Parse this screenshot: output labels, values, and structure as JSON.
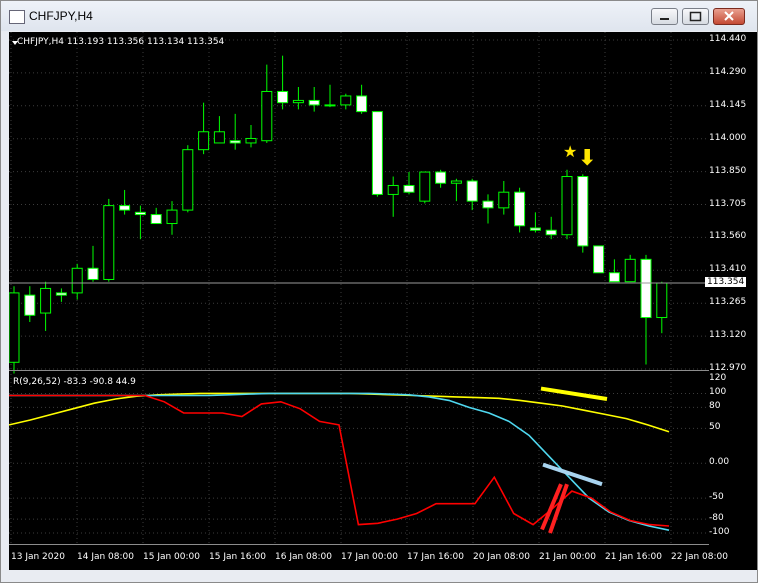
{
  "window": {
    "title": "CHFJPY,H4",
    "buttons": [
      "minimize",
      "maximize",
      "close"
    ]
  },
  "price_panel": {
    "info_text": "CHFJPY,H4  113.193 113.356 113.134 113.354",
    "current_price": "113.354",
    "y_labels": [
      "114.440",
      "114.290",
      "114.145",
      "114.000",
      "113.850",
      "113.705",
      "113.560",
      "113.410",
      "113.265",
      "113.120",
      "112.970"
    ]
  },
  "indicator_panel": {
    "info_text": "R(9,26,52) -83.3 -90.8 44.9",
    "y_labels": [
      "120",
      "100",
      "80",
      "50",
      "0.00",
      "-50",
      "-80",
      "-100"
    ]
  },
  "x_labels": [
    "13 Jan 2020",
    "14 Jan 08:00",
    "15 Jan 00:00",
    "15 Jan 16:00",
    "16 Jan 08:00",
    "17 Jan 00:00",
    "17 Jan 16:00",
    "20 Jan 08:00",
    "21 Jan 00:00",
    "21 Jan 16:00",
    "22 Jan 08:00"
  ],
  "colors": {
    "background": "#000000",
    "bull_candle": "#000000",
    "bear_candle": "#ffffff",
    "wick": "#00ff00",
    "line_red": "#ff0000",
    "line_cyan": "#4fd8f0",
    "line_yellow": "#ffff00",
    "star_arrow": "#ffe600",
    "drawn_red": "#ff2020",
    "drawn_blue": "#a8d4f0"
  },
  "chart_data": {
    "type": "candlestick",
    "price_range": [
      112.97,
      114.44
    ],
    "candles": [
      {
        "o": 113.0,
        "h": 113.34,
        "l": 112.95,
        "c": 113.31
      },
      {
        "o": 113.3,
        "h": 113.34,
        "l": 113.18,
        "c": 113.21
      },
      {
        "o": 113.22,
        "h": 113.36,
        "l": 113.14,
        "c": 113.33
      },
      {
        "o": 113.31,
        "h": 113.33,
        "l": 113.27,
        "c": 113.3
      },
      {
        "o": 113.31,
        "h": 113.44,
        "l": 113.28,
        "c": 113.42
      },
      {
        "o": 113.42,
        "h": 113.52,
        "l": 113.36,
        "c": 113.37
      },
      {
        "o": 113.37,
        "h": 113.73,
        "l": 113.36,
        "c": 113.7
      },
      {
        "o": 113.7,
        "h": 113.77,
        "l": 113.66,
        "c": 113.68
      },
      {
        "o": 113.67,
        "h": 113.7,
        "l": 113.55,
        "c": 113.66
      },
      {
        "o": 113.66,
        "h": 113.69,
        "l": 113.62,
        "c": 113.62
      },
      {
        "o": 113.62,
        "h": 113.72,
        "l": 113.57,
        "c": 113.68
      },
      {
        "o": 113.68,
        "h": 113.97,
        "l": 113.67,
        "c": 113.95
      },
      {
        "o": 113.95,
        "h": 114.16,
        "l": 113.93,
        "c": 114.03
      },
      {
        "o": 113.98,
        "h": 114.1,
        "l": 113.98,
        "c": 114.03
      },
      {
        "o": 113.99,
        "h": 114.11,
        "l": 113.95,
        "c": 113.98
      },
      {
        "o": 113.98,
        "h": 114.06,
        "l": 113.96,
        "c": 114.0
      },
      {
        "o": 113.99,
        "h": 114.33,
        "l": 113.98,
        "c": 114.21
      },
      {
        "o": 114.21,
        "h": 114.37,
        "l": 114.13,
        "c": 114.16
      },
      {
        "o": 114.16,
        "h": 114.23,
        "l": 114.13,
        "c": 114.17
      },
      {
        "o": 114.17,
        "h": 114.23,
        "l": 114.12,
        "c": 114.15
      },
      {
        "o": 114.15,
        "h": 114.24,
        "l": 114.14,
        "c": 114.15
      },
      {
        "o": 114.15,
        "h": 114.2,
        "l": 114.13,
        "c": 114.19
      },
      {
        "o": 114.19,
        "h": 114.24,
        "l": 114.11,
        "c": 114.12
      },
      {
        "o": 114.12,
        "h": 114.12,
        "l": 113.74,
        "c": 113.75
      },
      {
        "o": 113.75,
        "h": 113.83,
        "l": 113.65,
        "c": 113.79
      },
      {
        "o": 113.79,
        "h": 113.85,
        "l": 113.75,
        "c": 113.76
      },
      {
        "o": 113.72,
        "h": 113.85,
        "l": 113.71,
        "c": 113.85
      },
      {
        "o": 113.85,
        "h": 113.86,
        "l": 113.78,
        "c": 113.8
      },
      {
        "o": 113.8,
        "h": 113.82,
        "l": 113.72,
        "c": 113.81
      },
      {
        "o": 113.81,
        "h": 113.82,
        "l": 113.68,
        "c": 113.72
      },
      {
        "o": 113.72,
        "h": 113.75,
        "l": 113.62,
        "c": 113.69
      },
      {
        "o": 113.69,
        "h": 113.81,
        "l": 113.66,
        "c": 113.76
      },
      {
        "o": 113.76,
        "h": 113.78,
        "l": 113.58,
        "c": 113.61
      },
      {
        "o": 113.6,
        "h": 113.67,
        "l": 113.58,
        "c": 113.59
      },
      {
        "o": 113.59,
        "h": 113.65,
        "l": 113.55,
        "c": 113.57
      },
      {
        "o": 113.57,
        "h": 113.86,
        "l": 113.55,
        "c": 113.83
      },
      {
        "o": 113.83,
        "h": 113.84,
        "l": 113.49,
        "c": 113.52
      },
      {
        "o": 113.52,
        "h": 113.52,
        "l": 113.4,
        "c": 113.4
      },
      {
        "o": 113.4,
        "h": 113.46,
        "l": 113.36,
        "c": 113.36
      },
      {
        "o": 113.36,
        "h": 113.48,
        "l": 113.36,
        "c": 113.46
      },
      {
        "o": 113.46,
        "h": 113.48,
        "l": 112.99,
        "c": 113.2
      },
      {
        "o": 113.2,
        "h": 113.36,
        "l": 113.13,
        "c": 113.354
      }
    ],
    "indicator_range": [
      -110,
      125
    ],
    "red_line": [
      97,
      97,
      97,
      97,
      97,
      97,
      97,
      97,
      88,
      72,
      72,
      72,
      67,
      85,
      88,
      78,
      60,
      55,
      -88,
      -86,
      -80,
      -72,
      -58,
      -58,
      -58,
      -20,
      -72,
      -88,
      -65,
      -40,
      -50,
      -70,
      -82,
      -88,
      -90
    ],
    "cyan_line": [
      97,
      97,
      97,
      97,
      97,
      97,
      97,
      97,
      97,
      97,
      97,
      98,
      99,
      100,
      100,
      100,
      100,
      100,
      100,
      99,
      98,
      95,
      90,
      80,
      72,
      60,
      40,
      10,
      -20,
      -50,
      -70,
      -82,
      -90,
      -96
    ],
    "yellow_line": [
      55,
      62,
      70,
      78,
      86,
      92,
      96,
      98,
      99,
      100,
      100,
      100,
      100,
      100,
      100,
      100,
      100,
      99,
      98,
      97,
      96,
      95,
      94,
      93,
      90,
      86,
      82,
      76,
      70,
      64,
      55,
      45
    ]
  },
  "annotations": {
    "star": "★",
    "arrow": "⬇"
  }
}
